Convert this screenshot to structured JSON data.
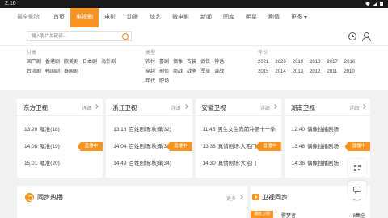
{
  "status_bar": {
    "time": "2:10"
  },
  "nav": {
    "brand": "最全影院",
    "items": [
      "首页",
      "电视剧",
      "电影",
      "动漫",
      "综艺",
      "微电影",
      "新闻",
      "图库",
      "明星",
      "剧情",
      "更多"
    ],
    "active": "电视剧"
  },
  "search": {
    "placeholder": "输入影片关键词..."
  },
  "filters": {
    "region": {
      "title": "分类",
      "row1": [
        "国产剧",
        "香港剧",
        "欧美剧",
        "日本剧",
        "海外剧"
      ],
      "row2": [
        "台湾剧",
        "韩国剧",
        "泰国剧"
      ]
    },
    "genre": {
      "title": "类型",
      "row1": [
        "农村",
        "喜剧",
        "偶像",
        "古装",
        "武侠",
        "神话"
      ],
      "row2": [
        "穿越",
        "刑侦",
        "商战",
        "战争",
        "军旅",
        "谍战"
      ],
      "row3": [
        "年代",
        "职场"
      ]
    },
    "year": {
      "title": "年份",
      "row1": [
        "2021",
        "2020",
        "2019",
        "2018",
        "2017",
        "2016"
      ],
      "row2": [
        "2015",
        "2014",
        "2013",
        "2012",
        "2011",
        "2010"
      ]
    }
  },
  "channels": [
    {
      "name": "东方卫视",
      "more": "详细",
      "programs": [
        {
          "time": "13:20",
          "title": "嘱准(18)",
          "live": false
        },
        {
          "time": "14:08",
          "title": "嘱准(19)",
          "live": true
        },
        {
          "time": "15:01",
          "title": "嘱准(20)",
          "live": false
        }
      ]
    },
    {
      "name": "浙江卫视",
      "more": "详细",
      "programs": [
        {
          "time": "13:18",
          "title": "百姓剧场:秋蝉(32)",
          "live": false
        },
        {
          "time": "14:04",
          "title": "百姓剧场:秋蝉(33)",
          "live": true
        },
        {
          "time": "14:49",
          "title": "百姓剧场:秋蝉(34)",
          "live": false
        }
      ]
    },
    {
      "name": "安徽卫视",
      "more": "详细",
      "programs": [
        {
          "time": "11:45",
          "title": "男生女生向前冲第十一季",
          "live": false
        },
        {
          "time": "13:38",
          "title": "真情剧场:大宅门",
          "live": true
        },
        {
          "time": "14:30",
          "title": "真情剧场:大宅门",
          "live": false
        }
      ]
    },
    {
      "name": "湖南卫视",
      "more": "详细",
      "programs": [
        {
          "time": "12:40",
          "title": "偶像独播剧场",
          "live": false
        },
        {
          "time": "13:48",
          "title": "偶像独播剧场",
          "live": true
        },
        {
          "time": "14:36",
          "title": "偶像独播剧场",
          "live": false
        }
      ]
    }
  ],
  "live_label": "直播中",
  "hot": {
    "title": "同步热播",
    "more": "更多"
  },
  "tv_sync": {
    "title": "卫视同步",
    "more": "更多",
    "rank_tag": "湖南卫视",
    "rank_name": "警梦者",
    "rank_ep": "8集全"
  },
  "accent_color": "#f7931e"
}
